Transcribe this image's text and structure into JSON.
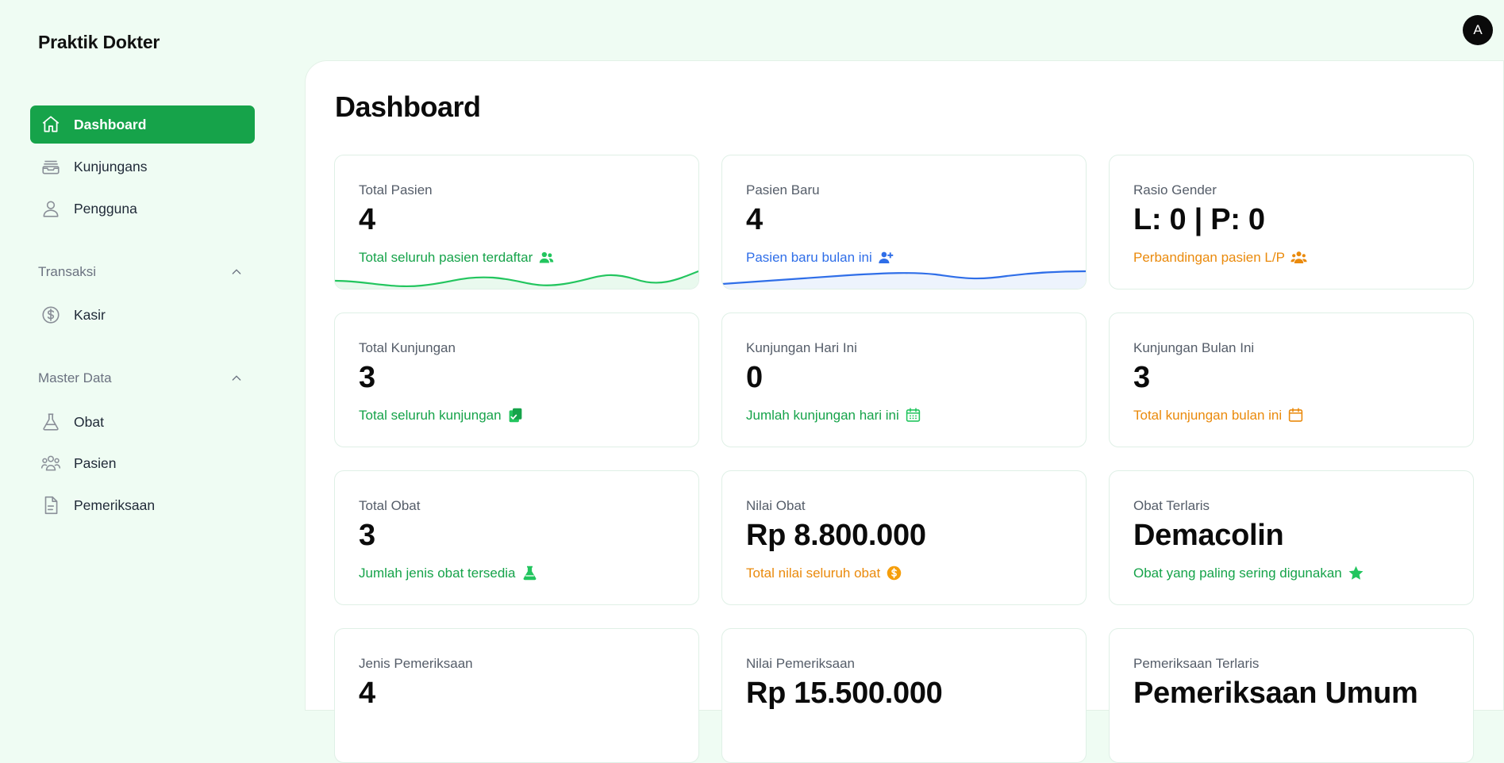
{
  "brand": "Praktik Dokter",
  "avatar_initial": "A",
  "nav": {
    "dashboard": "Dashboard",
    "kunjungans": "Kunjungans",
    "pengguna": "Pengguna",
    "transaksi_group": "Transaksi",
    "kasir": "Kasir",
    "master_group": "Master Data",
    "obat": "Obat",
    "pasien": "Pasien",
    "pemeriksaan": "Pemeriksaan"
  },
  "page_title": "Dashboard",
  "cards": {
    "total_pasien": {
      "label": "Total Pasien",
      "value": "4",
      "desc": "Total seluruh pasien terdaftar"
    },
    "pasien_baru": {
      "label": "Pasien Baru",
      "value": "4",
      "desc": "Pasien baru bulan ini"
    },
    "rasio_gender": {
      "label": "Rasio Gender",
      "value": "L: 0 | P: 0",
      "desc": "Perbandingan pasien L/P"
    },
    "total_kunjungan": {
      "label": "Total Kunjungan",
      "value": "3",
      "desc": "Total seluruh kunjungan"
    },
    "kunjungan_hari_ini": {
      "label": "Kunjungan Hari Ini",
      "value": "0",
      "desc": "Jumlah kunjungan hari ini"
    },
    "kunjungan_bulan_ini": {
      "label": "Kunjungan Bulan Ini",
      "value": "3",
      "desc": "Total kunjungan bulan ini"
    },
    "total_obat": {
      "label": "Total Obat",
      "value": "3",
      "desc": "Jumlah jenis obat tersedia"
    },
    "nilai_obat": {
      "label": "Nilai Obat",
      "value": "Rp 8.800.000",
      "desc": "Total nilai seluruh obat"
    },
    "obat_terlaris": {
      "label": "Obat Terlaris",
      "value": "Demacolin",
      "desc": "Obat yang paling sering digunakan"
    },
    "jenis_pemeriksaan": {
      "label": "Jenis Pemeriksaan",
      "value": "4"
    },
    "nilai_pemeriksaan": {
      "label": "Nilai Pemeriksaan",
      "value": "Rp 15.500.000"
    },
    "pemeriksaan_terlaris": {
      "label": "Pemeriksaan Terlaris",
      "value": "Pemeriksaan Umum"
    }
  },
  "colors": {
    "primary": "#16a34a",
    "blue": "#2f6ee8",
    "orange": "#ea8a0c",
    "background": "#effcf3"
  },
  "icons": [
    "home-icon",
    "inbox-icon",
    "user-icon",
    "chevron-up-icon",
    "dollar-icon",
    "flask-icon",
    "users-icon",
    "document-icon",
    "user-plus-icon",
    "clipboard-check-icon",
    "calendar-icon",
    "star-icon"
  ]
}
